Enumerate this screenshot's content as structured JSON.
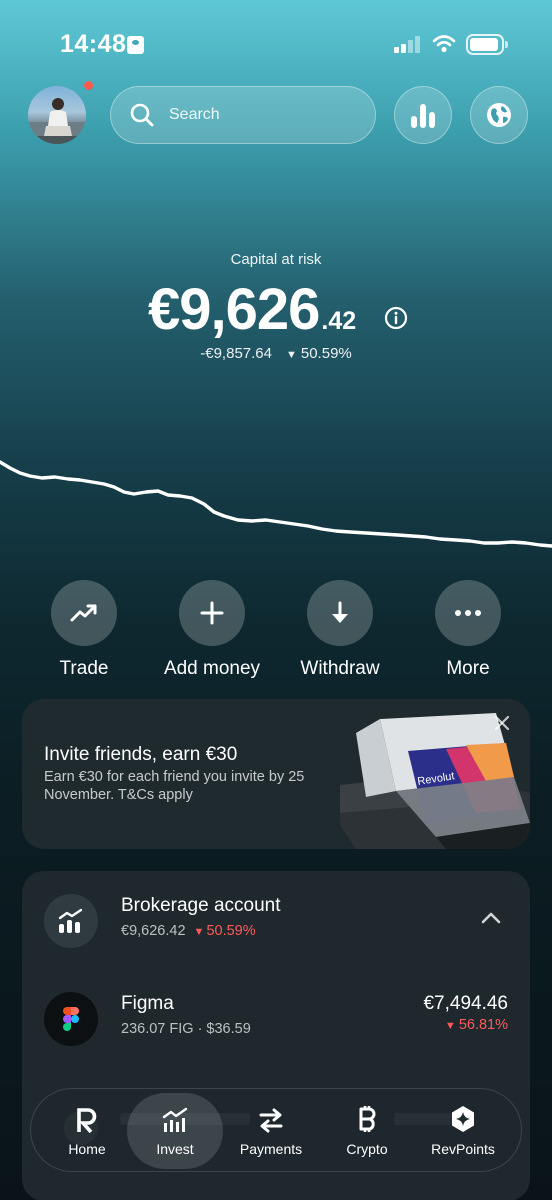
{
  "status_bar": {
    "time": "14:48"
  },
  "header": {
    "search_placeholder": "Search"
  },
  "portfolio": {
    "label": "Capital at risk",
    "balance_main": "€9,626",
    "balance_decimal": ".42",
    "change_amount": "-€9,857.64",
    "change_percent": "50.59%",
    "trend": "down"
  },
  "actions": [
    {
      "label": "Trade",
      "icon": "trending-up-icon"
    },
    {
      "label": "Add money",
      "icon": "plus-icon"
    },
    {
      "label": "Withdraw",
      "icon": "arrow-down-icon"
    },
    {
      "label": "More",
      "icon": "more-icon"
    }
  ],
  "promo": {
    "title": "Invite friends, earn €30",
    "text": "Earn €30 for each friend you invite by 25 November. T&Cs apply",
    "card_brand": "Revolut"
  },
  "account": {
    "title": "Brokerage account",
    "value": "€9,626.42",
    "change": "50.59%",
    "holdings": [
      {
        "name": "Figma",
        "detail": "236.07 FIG · $36.59",
        "value": "€7,494.46",
        "change": "56.81%"
      }
    ]
  },
  "tabbar": {
    "items": [
      {
        "label": "Home",
        "icon": "revolut-r-icon"
      },
      {
        "label": "Invest",
        "icon": "invest-chart-icon",
        "active": true
      },
      {
        "label": "Payments",
        "icon": "transfer-arrows-icon"
      },
      {
        "label": "Crypto",
        "icon": "bitcoin-icon"
      },
      {
        "label": "RevPoints",
        "icon": "revpoints-icon"
      }
    ]
  },
  "colors": {
    "negative": "#ff5a5a",
    "card_bg": "#1e282d",
    "accent_top": "#5fc8d6"
  }
}
